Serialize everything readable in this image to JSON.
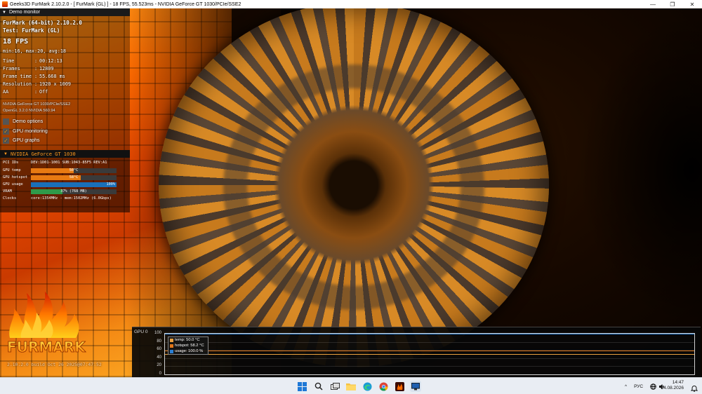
{
  "window": {
    "title": "Geeks3D FurMark 2.10.2.0 - [ FurMark (GL) ] - 18 FPS, 55.523ms - NVIDIA GeForce GT 1030/PCIe/SSE2",
    "minimize_glyph": "—",
    "maximize_glyph": "❐",
    "close_glyph": "✕"
  },
  "demo_monitor": {
    "header": "Demo monitor",
    "app_line": "FurMark (64-bit) 2.10.2.0",
    "test_line": "Test: FurMark (GL)",
    "fps_big": "18 FPS",
    "fps_stats": "min:16, max:20, avg:18",
    "stats": [
      {
        "label": "Time",
        "value": "00:12:13"
      },
      {
        "label": "Frames",
        "value": "12809"
      },
      {
        "label": "Frame time",
        "value": "55.668 ms"
      },
      {
        "label": "Resolution",
        "value": "1920 x 1009"
      },
      {
        "label": "AA",
        "value": "Off"
      }
    ],
    "renderer": "NVIDIA GeForce GT 1030/PCIe/SSE2",
    "opengl": "OpenGL 3.2.0 NVIDIA 560.94",
    "options": [
      {
        "label": "Demo options",
        "checked": false
      },
      {
        "label": "GPU monitoring",
        "checked": true
      },
      {
        "label": "GPU graphs",
        "checked": true
      }
    ]
  },
  "gpu_panel": {
    "name": "NVIDIA GeForce GT 1030",
    "pci_label": "PCI IDs",
    "pci_value": "DEV:1D01-1001 SUB:1043-85F5 REV:A1",
    "rows": [
      {
        "label": "GPU temp",
        "value": "50°C",
        "fill": 0.5,
        "color": "#e87a12"
      },
      {
        "label": "GPU hotspot",
        "value": "58°C",
        "fill": 0.58,
        "color": "#e87a12"
      },
      {
        "label": "GPU usage",
        "value": "100%",
        "fill": 1.0,
        "color": "#1a6fb8"
      },
      {
        "label": "VRAM",
        "value": "37% (768 MB)",
        "fill": 0.37,
        "color": "#2f9a4a"
      }
    ],
    "clocks_label": "Clocks",
    "clocks_value": "core:1354MHz - mem:1502MHz (6.0Gbps)"
  },
  "logo": {
    "text": "FURMARK"
  },
  "build_info": "2.10.2.0 build Oct 26 2025@07:47:52",
  "chart_data": {
    "type": "line",
    "title": "GPU 0",
    "ylim": [
      0,
      100
    ],
    "yticks": [
      "100",
      "80",
      "60",
      "40",
      "20",
      "0"
    ],
    "grid": true,
    "legend_position": "top-left",
    "series": [
      {
        "name": "temp: 50.0 °C",
        "value": 50.0,
        "color": "#e8a040"
      },
      {
        "name": "hotspot: 58.2 °C",
        "value": 58.2,
        "color": "#e0761a"
      },
      {
        "name": "usage: 100.0 %",
        "value": 100.0,
        "color": "#2a7fd4"
      }
    ]
  },
  "taskbar": {
    "icons": [
      "windows-start-icon",
      "search-icon",
      "task-view-icon",
      "file-explorer-icon",
      "edge-icon",
      "chrome-icon",
      "furmark-icon",
      "furmark-monitor-icon"
    ],
    "tray_chevron": "^",
    "language": "РУС",
    "time": "14:47",
    "date": "24.08.2026"
  }
}
